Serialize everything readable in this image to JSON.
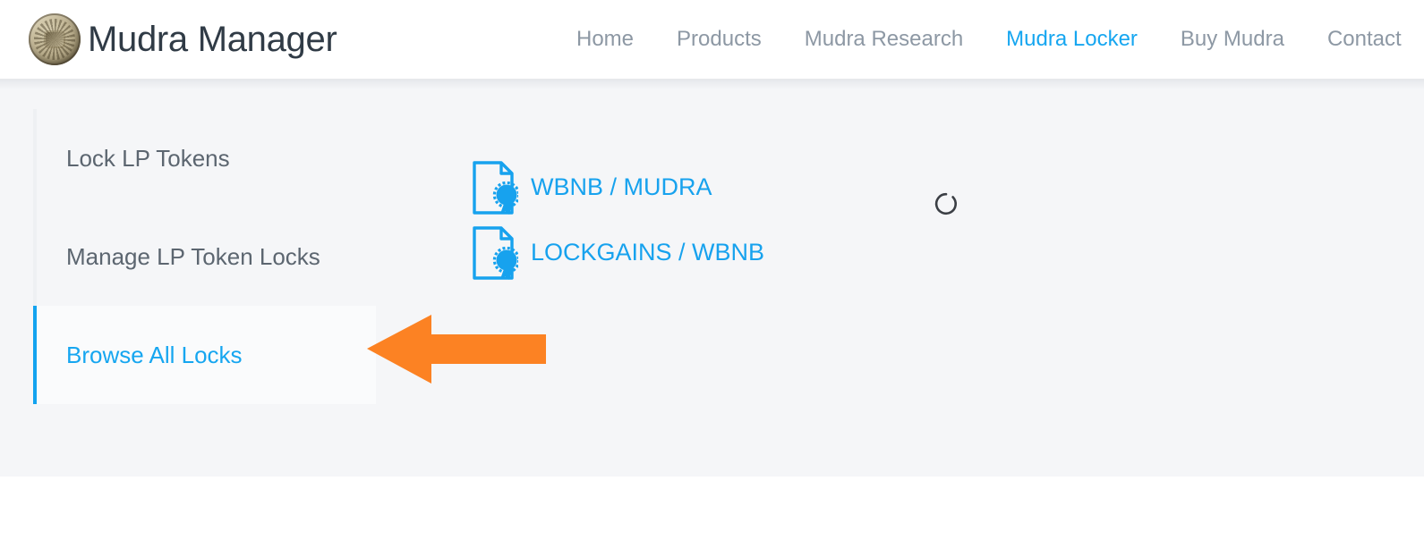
{
  "header": {
    "brand_title": "Mudra Manager",
    "logo_icon": "coin-logo-icon",
    "nav": [
      {
        "label": "Home",
        "active": false
      },
      {
        "label": "Products",
        "active": false
      },
      {
        "label": "Mudra Research",
        "active": false
      },
      {
        "label": "Mudra Locker",
        "active": true
      },
      {
        "label": "Buy Mudra",
        "active": false
      },
      {
        "label": "Contact",
        "active": false
      }
    ]
  },
  "sidebar": {
    "items": [
      {
        "label": "Lock LP Tokens",
        "active": false
      },
      {
        "label": "Manage LP Token Locks",
        "active": false
      },
      {
        "label": "Browse All Locks",
        "active": true
      }
    ]
  },
  "main": {
    "loading_indicator": "loading-spinner",
    "locks": [
      {
        "label": "WBNB / MUDRA",
        "icon": "certificate-icon"
      },
      {
        "label": "LOCKGAINS / WBNB",
        "icon": "certificate-icon"
      }
    ]
  },
  "annotation": {
    "arrow": "left-pointing-arrow",
    "color": "#fc8223"
  },
  "colors": {
    "accent_blue": "#16a6f0",
    "link_blue": "#17a2ee",
    "nav_inactive": "#8d98a4",
    "sidebar_text": "#5c6670",
    "brand_text": "#303b46",
    "panel_bg": "#f5f6f8",
    "active_item_bg": "#fafbfc",
    "annotation_orange": "#fc8223"
  }
}
